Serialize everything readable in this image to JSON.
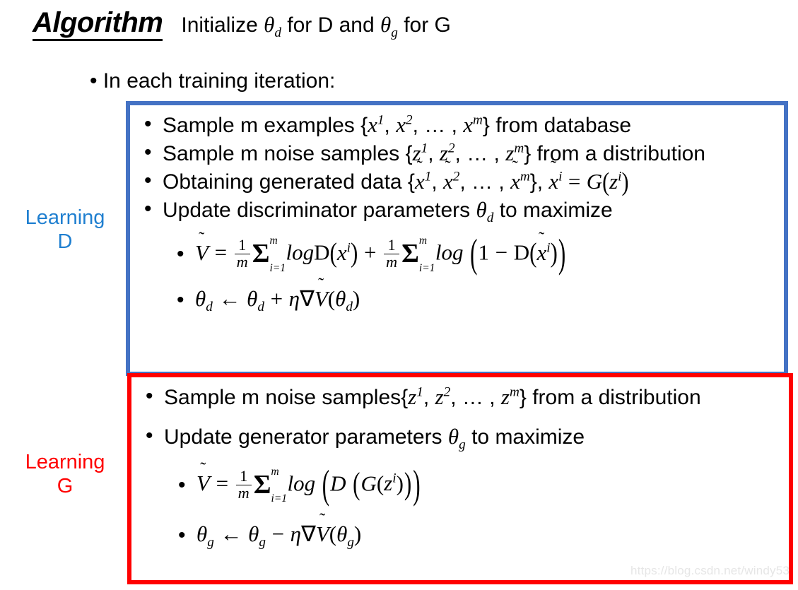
{
  "slide": {
    "title": "Algorithm",
    "init_text_prefix": "Initialize ",
    "init_theta_d": "θ",
    "init_sub_d": "d",
    "init_mid": " for D and ",
    "init_theta_g": "θ",
    "init_sub_g": "g",
    "init_suffix": " for G",
    "iteration_bullet": "• In each training iteration:",
    "bullet_glyph": "•",
    "watermark": "https://blog.csdn.net/windy53"
  },
  "colors": {
    "blue_box_border": "#4472C4",
    "red_box_border": "#FF0000",
    "learning_d_text": "#1F7FD0",
    "learning_g_text": "#FF0000",
    "background": "#FFFFFF",
    "text": "#000000",
    "watermark": "#E6E6E6"
  },
  "side_labels": {
    "learning_d": "Learning\nD",
    "learning_d_line1": "Learning",
    "learning_d_line2": "D",
    "learning_g_line1": "Learning",
    "learning_g_line2": "G"
  },
  "discriminator_block": {
    "name": "Learning D",
    "bullets": [
      {
        "id": "sample-examples",
        "text_before": "Sample m examples {",
        "var": "x",
        "sup1": "1",
        "sep1": ", ",
        "sup2": "2",
        "sep2": ", … , ",
        "supm": "m",
        "text_after": "} from database",
        "plain": "Sample m examples {x1, x2, … , xm} from database"
      },
      {
        "id": "sample-noise",
        "text_before": "Sample m noise samples {",
        "var": "z",
        "text_after": "} from a distribution",
        "plain": "Sample m noise samples {z1, z2, … , zm} from a distribution"
      },
      {
        "id": "obtain-generated",
        "text_before": "Obtaining generated data {",
        "var": "x̃",
        "text_after": "}, x̃i = G(zi)",
        "plain": "Obtaining generated data {x̃1, x̃2, … , x̃m}, x̃i = G(zi)"
      },
      {
        "id": "update-discriminator",
        "text_before": "Update discriminator parameters ",
        "theta": "θ",
        "theta_sub": "d",
        "text_after": " to maximize",
        "plain": "Update discriminator parameters θd to maximize"
      }
    ],
    "equations": [
      {
        "id": "v-tilde-discriminator",
        "latex": "\\tilde{V} = \\frac{1}{m}\\sum_{i=1}^{m} logD(x^i) + \\frac{1}{m}\\sum_{i=1}^{m} log\\left(1 - D(\\tilde{x}^i)\\right)",
        "plain": "Ṽ = 1/m Σ_{i=1}^{m} logD(x^i) + 1/m Σ_{i=1}^{m} log(1 − D(x̃^i))"
      },
      {
        "id": "theta-d-update",
        "latex": "\\theta_d \\leftarrow \\theta_d + \\eta\\nabla\\tilde{V}(\\theta_d)",
        "plain": "θ_d ← θ_d + η∇Ṽ(θ_d)"
      }
    ]
  },
  "generator_block": {
    "name": "Learning G",
    "bullets": [
      {
        "id": "sample-noise-g",
        "text_before": "Sample m noise samples{",
        "var": "z",
        "text_after": "} from a distribution",
        "plain": "Sample m noise samples{z1, z2, … , zm} from a distribution"
      },
      {
        "id": "update-generator",
        "text_before": "Update generator parameters ",
        "theta": "θ",
        "theta_sub": "g",
        "text_after": " to maximize",
        "plain": "Update generator parameters θg to maximize"
      }
    ],
    "equations": [
      {
        "id": "v-tilde-generator",
        "latex": "\\tilde{V} = \\frac{1}{m}\\sum_{i=1}^{m} log\\left(D\\left(G(z^i)\\right)\\right)",
        "plain": "Ṽ = 1/m Σ_{i=1}^{m} log(D(G(z^i)))"
      },
      {
        "id": "theta-g-update",
        "latex": "\\theta_g \\leftarrow \\theta_g - \\eta\\nabla\\tilde{V}(\\theta_g)",
        "plain": "θ_g ← θ_g − η∇Ṽ(θ_g)"
      }
    ]
  },
  "symbols": {
    "theta": "θ",
    "eta": "η",
    "nabla": "∇",
    "sigma": "Σ",
    "arrow_left": "←",
    "plus": "+",
    "minus": "−",
    "equals": "=",
    "ellipsis": "…",
    "tilde": "~",
    "one": "1",
    "m": "m",
    "i_eq_1": "i=1",
    "V": "V",
    "D": "D",
    "G": "G",
    "log": "log",
    "x": "x",
    "z": "z",
    "i": "i"
  }
}
